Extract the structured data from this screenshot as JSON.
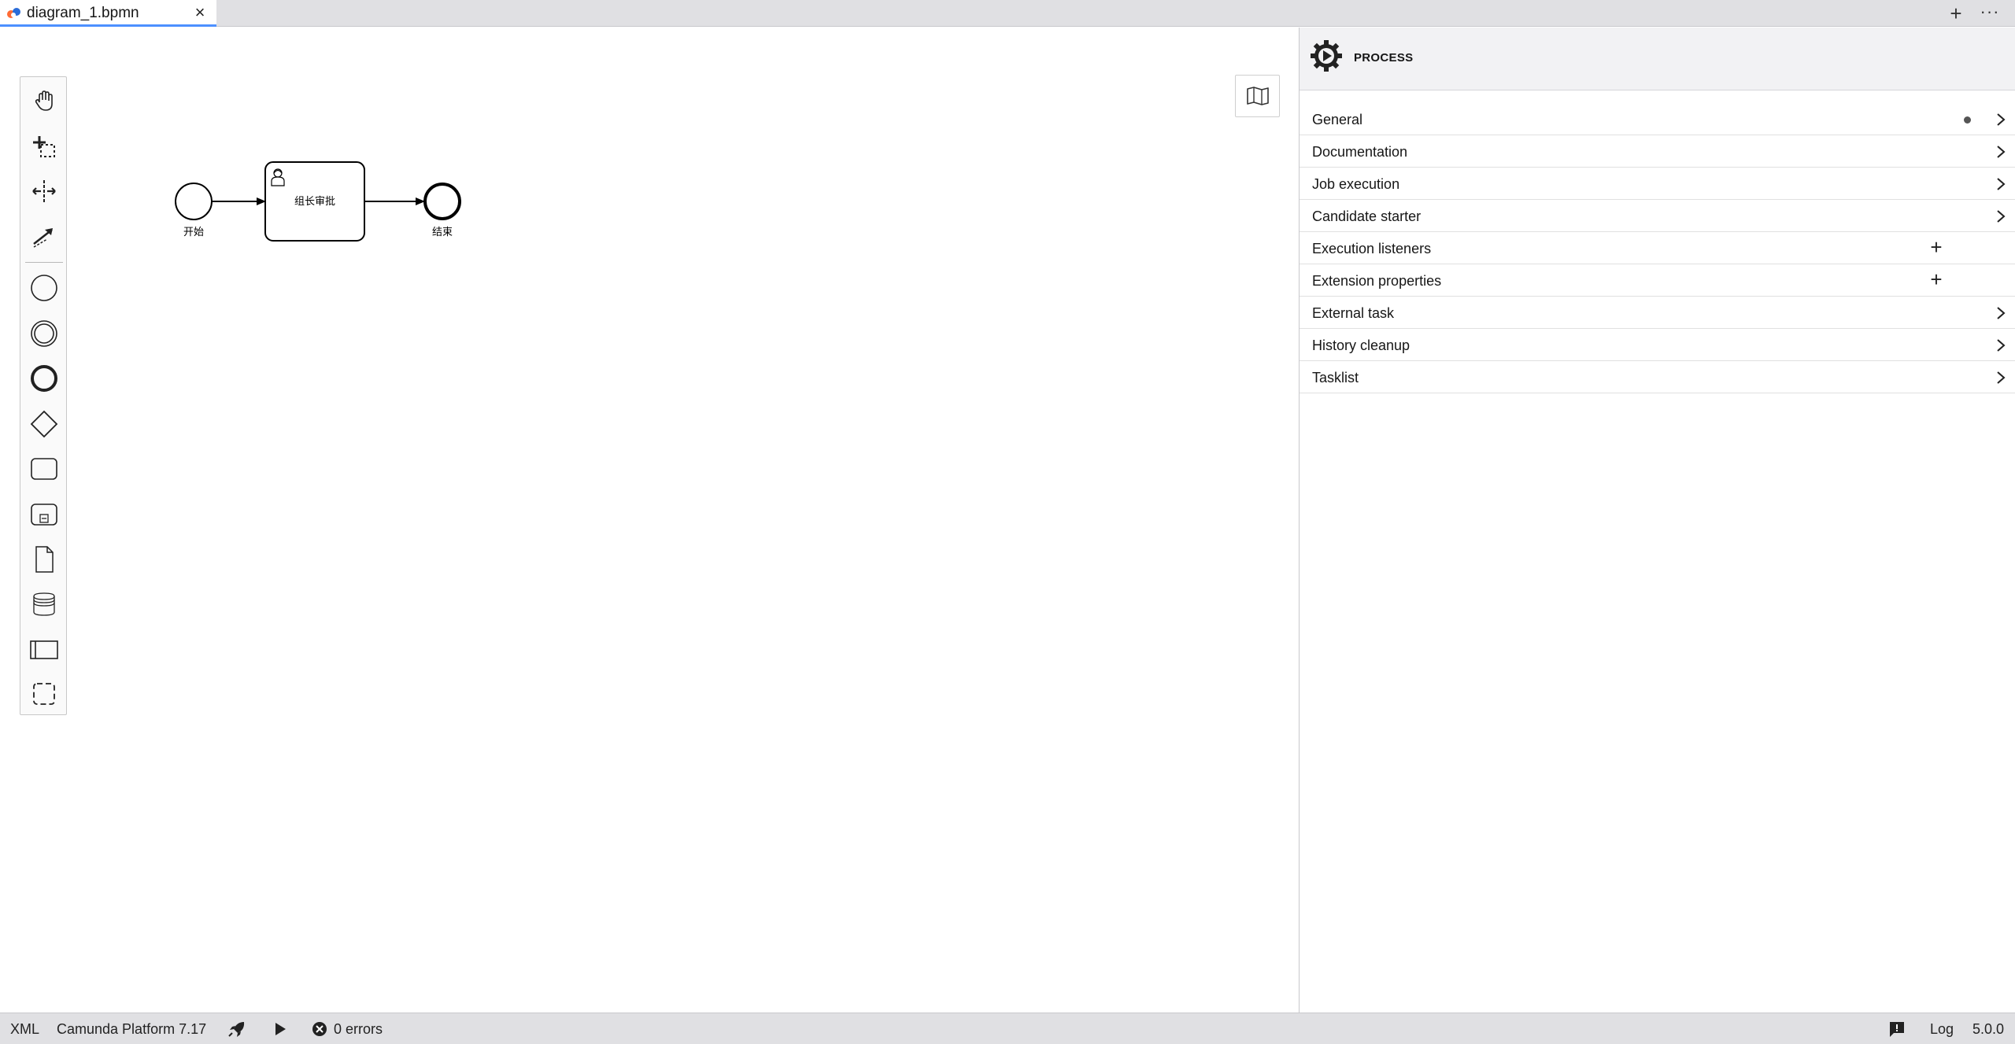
{
  "tabbar": {
    "tab_title": "diagram_1.bpmn",
    "close_glyph": "×",
    "add_glyph": "+",
    "more_glyph": "···"
  },
  "palette": {
    "tools": [
      {
        "name": "hand-tool-icon"
      },
      {
        "name": "lasso-tool-icon"
      },
      {
        "name": "space-tool-icon"
      },
      {
        "name": "global-connect-tool-icon"
      },
      {
        "name": "start-event-icon"
      },
      {
        "name": "intermediate-event-icon"
      },
      {
        "name": "end-event-icon"
      },
      {
        "name": "gateway-icon"
      },
      {
        "name": "task-icon"
      },
      {
        "name": "subprocess-icon"
      },
      {
        "name": "data-object-icon"
      },
      {
        "name": "data-store-icon"
      },
      {
        "name": "participant-icon"
      },
      {
        "name": "group-icon"
      }
    ]
  },
  "diagram": {
    "start_event_label": "开始",
    "user_task_label": "组长审批",
    "end_event_label": "结束"
  },
  "properties": {
    "header_title": "PROCESS",
    "groups": [
      {
        "label": "General",
        "indicator": "dot"
      },
      {
        "label": "Documentation"
      },
      {
        "label": "Job execution"
      },
      {
        "label": "Candidate starter"
      },
      {
        "label": "Execution listeners",
        "action": "+"
      },
      {
        "label": "Extension properties",
        "action": "+"
      },
      {
        "label": "External task"
      },
      {
        "label": "History cleanup"
      },
      {
        "label": "Tasklist"
      }
    ]
  },
  "statusbar": {
    "xml": "XML",
    "platform": "Camunda Platform 7.17",
    "errors": "0 errors",
    "log": "Log",
    "version": "5.0.0"
  },
  "colors": {
    "accent": "#4d90ff",
    "chrome": "#e0e0e3",
    "panel_header": "#f2f2f4"
  }
}
